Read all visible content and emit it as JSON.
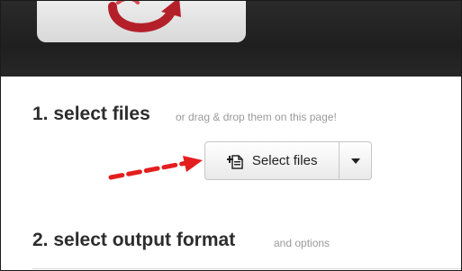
{
  "step1": {
    "heading": "1. select files",
    "note": "or drag & drop them on this page!"
  },
  "upload": {
    "select_label": "Select files",
    "icon": "add-file-icon",
    "dropdown_icon": "chevron-down-icon"
  },
  "step2": {
    "heading": "2. select output format",
    "note": "and options"
  },
  "colors": {
    "header": "#222222",
    "accent_red": "#e41e1e",
    "logo_red": "#b5202a"
  }
}
